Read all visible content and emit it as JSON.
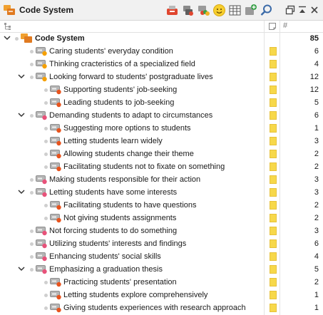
{
  "panel": {
    "title": "Code System",
    "count_column_header": "#"
  },
  "toolbar": [
    "new-code-icon",
    "code-set-icon",
    "activate-codes-icon",
    "emoji-icon",
    "table-view-icon",
    "add-image-icon",
    "search-icon"
  ],
  "colors": {
    "root": "#f0a030",
    "orange": "#f5a000",
    "red": "#e8541e",
    "pink": "#e8527a",
    "memo": "#f7d84a"
  },
  "root": {
    "label": "Code System",
    "count": "85"
  },
  "codes": [
    {
      "label": "Caring students' everyday condition",
      "count": "6",
      "level": 1,
      "color": "orange",
      "expanded": false,
      "has_children": false
    },
    {
      "label": "Thinking cracteristics of a specialized field",
      "count": "4",
      "level": 1,
      "color": "orange",
      "expanded": false,
      "has_children": false
    },
    {
      "label": "Looking forward to students' postgraduate lives",
      "count": "12",
      "level": 1,
      "color": "orange",
      "expanded": true,
      "has_children": true
    },
    {
      "label": "Supporting students' job-seeking",
      "count": "12",
      "level": 2,
      "color": "red",
      "expanded": false,
      "has_children": false
    },
    {
      "label": "Leading students to job-seeking",
      "count": "5",
      "level": 2,
      "color": "red",
      "expanded": false,
      "has_children": false
    },
    {
      "label": "Demanding students to adapt to circumstances",
      "count": "6",
      "level": 1,
      "color": "pink",
      "expanded": true,
      "has_children": true
    },
    {
      "label": "Suggesting more options to students",
      "count": "1",
      "level": 2,
      "color": "red",
      "expanded": false,
      "has_children": false
    },
    {
      "label": "Letting students learn widely",
      "count": "3",
      "level": 2,
      "color": "red",
      "expanded": false,
      "has_children": false
    },
    {
      "label": "Allowing students change their theme",
      "count": "2",
      "level": 2,
      "color": "red",
      "expanded": false,
      "has_children": false
    },
    {
      "label": "Facilitating students not to fixate on something",
      "count": "2",
      "level": 2,
      "color": "red",
      "expanded": false,
      "has_children": false
    },
    {
      "label": "Making students responsible for their action",
      "count": "3",
      "level": 1,
      "color": "pink",
      "expanded": false,
      "has_children": false
    },
    {
      "label": "Letting students have some interests",
      "count": "3",
      "level": 1,
      "color": "pink",
      "expanded": true,
      "has_children": true
    },
    {
      "label": "Facilitating students to have questions",
      "count": "2",
      "level": 2,
      "color": "red",
      "expanded": false,
      "has_children": false
    },
    {
      "label": "Not giving students assignments",
      "count": "2",
      "level": 2,
      "color": "red",
      "expanded": false,
      "has_children": false
    },
    {
      "label": "Not forcing students to do something",
      "count": "3",
      "level": 1,
      "color": "pink",
      "expanded": false,
      "has_children": false
    },
    {
      "label": "Utilizing students' interests and findings",
      "count": "6",
      "level": 1,
      "color": "pink",
      "expanded": false,
      "has_children": false
    },
    {
      "label": "Enhancing students' social skills",
      "count": "4",
      "level": 1,
      "color": "pink",
      "expanded": false,
      "has_children": false
    },
    {
      "label": "Emphasizing a graduation thesis",
      "count": "5",
      "level": 1,
      "color": "pink",
      "expanded": true,
      "has_children": true
    },
    {
      "label": "Practicing students' presentation",
      "count": "2",
      "level": 2,
      "color": "red",
      "expanded": false,
      "has_children": false
    },
    {
      "label": "Letting students explore comprehensively",
      "count": "1",
      "level": 2,
      "color": "red",
      "expanded": false,
      "has_children": false
    },
    {
      "label": "Giving students experiences with research approach",
      "count": "1",
      "level": 2,
      "color": "red",
      "expanded": false,
      "has_children": false
    }
  ]
}
